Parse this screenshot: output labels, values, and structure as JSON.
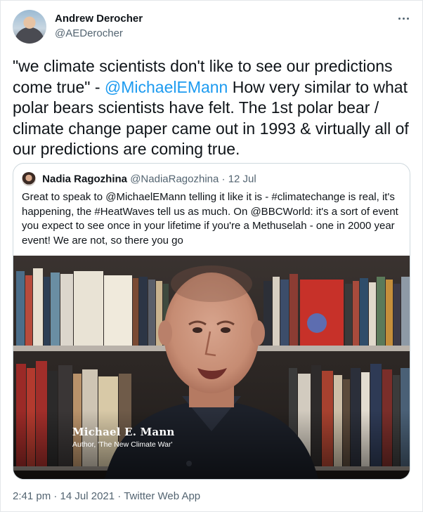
{
  "author": {
    "name": "Andrew Derocher",
    "handle": "@AEDerocher"
  },
  "tweet": {
    "text_before": "\"we climate scientists don't like to see our predictions come true\" - ",
    "mention": "@MichaelEMann",
    "text_after": " How very similar to what polar bears scientists have felt. The 1st polar bear / climate change paper came out in 1993 & virtually all of our predictions are coming true."
  },
  "quoted_tweet": {
    "name": "Nadia Ragozhina",
    "handle": "@NadiaRagozhina",
    "separator": "·",
    "date": "12 Jul",
    "text": "Great to speak to @MichaelEMann telling it like it is - #climatechange is real, it's happening, the #HeatWaves tell us as much. On @BBCWorld: it's a sort of event you expect to see once in your lifetime if you're a Methuselah - one in 2000 year event! We are not, so there you go",
    "media": {
      "caption_name": "Michael E. Mann",
      "caption_title": "Author, 'The New Climate War'"
    }
  },
  "meta": {
    "time": "2:41 pm",
    "sep1": "·",
    "date": "14 Jul 2021",
    "sep2": "·",
    "source": "Twitter Web App"
  },
  "icons": {
    "more": "more-horizontal-icon"
  }
}
